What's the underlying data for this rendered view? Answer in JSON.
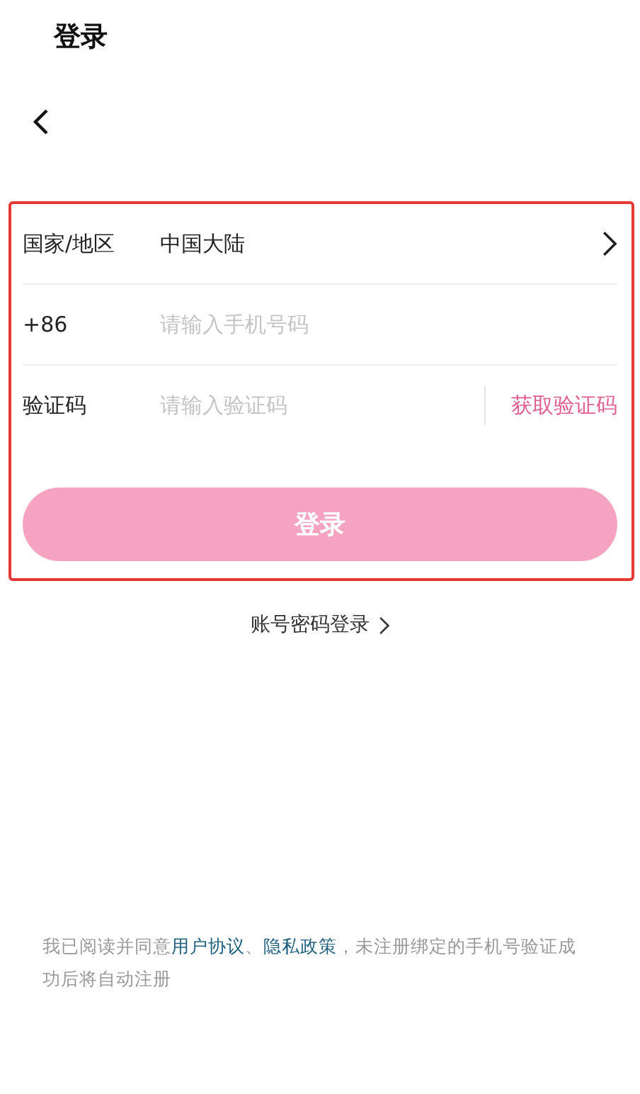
{
  "page_title": "登录",
  "form": {
    "highlighted": true,
    "rows": [
      {
        "kind": "select",
        "label": "国家/地区",
        "value": "中国大陆"
      },
      {
        "kind": "input",
        "label": "+86",
        "placeholder": "请输入手机号码"
      },
      {
        "kind": "code",
        "label": "验证码",
        "placeholder": "请输入验证码",
        "action": "获取验证码"
      }
    ],
    "submit": {
      "label": "登录",
      "disabled": true
    }
  },
  "alt_login": "账号密码登录",
  "agreement": [
    {
      "kind": "text",
      "text": "我已阅读并同意"
    },
    {
      "kind": "link",
      "text": "用户协议"
    },
    {
      "kind": "text",
      "text": "、"
    },
    {
      "kind": "link",
      "text": "隐私政策"
    },
    {
      "kind": "text",
      "text": "，未注册绑定的手机号验证成功后将自动注册"
    }
  ]
}
